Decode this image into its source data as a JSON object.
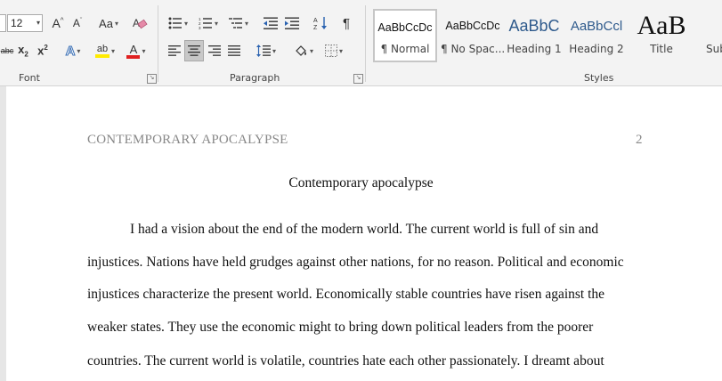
{
  "ribbon": {
    "font": {
      "label": "Font",
      "size": "12",
      "grow": "A",
      "shrink": "A",
      "case": "Aa",
      "subscript": "x",
      "superscript": "x",
      "strike": "abc",
      "text_effects": "A",
      "font_color": "A",
      "highlight_label": "ab",
      "underline_color": "#ffeb00",
      "font_color_value": "#e02020"
    },
    "paragraph": {
      "label": "Paragraph",
      "pilcrow": "¶"
    },
    "styles": {
      "label": "Styles",
      "items": [
        {
          "preview": "AaBbCcDc",
          "name": "¶ Normal"
        },
        {
          "preview": "AaBbCcDc",
          "name": "¶ No Spac..."
        },
        {
          "preview": "AaBbC",
          "name": "Heading 1"
        },
        {
          "preview": "AaBbCcl",
          "name": "Heading 2"
        },
        {
          "preview": "AaB",
          "name": "Title"
        },
        {
          "preview": "",
          "name": "Sub"
        }
      ],
      "heading_color": "#2e5a8c"
    }
  },
  "document": {
    "running_head": "CONTEMPORARY APOCALYPSE",
    "page_number": "2",
    "title": "Contemporary apocalypse",
    "lines": [
      "I had a vision about the end of the modern world. The current world is full of sin and",
      "injustices. Nations have held grudges against other nations, for no reason. Political and economic",
      "injustices characterize the present world. Economically stable countries have risen against the",
      "weaker states. They use the economic might to bring down political leaders from the poorer",
      "countries. The current world is volatile, countries hate each other passionately. I dreamt about"
    ]
  }
}
